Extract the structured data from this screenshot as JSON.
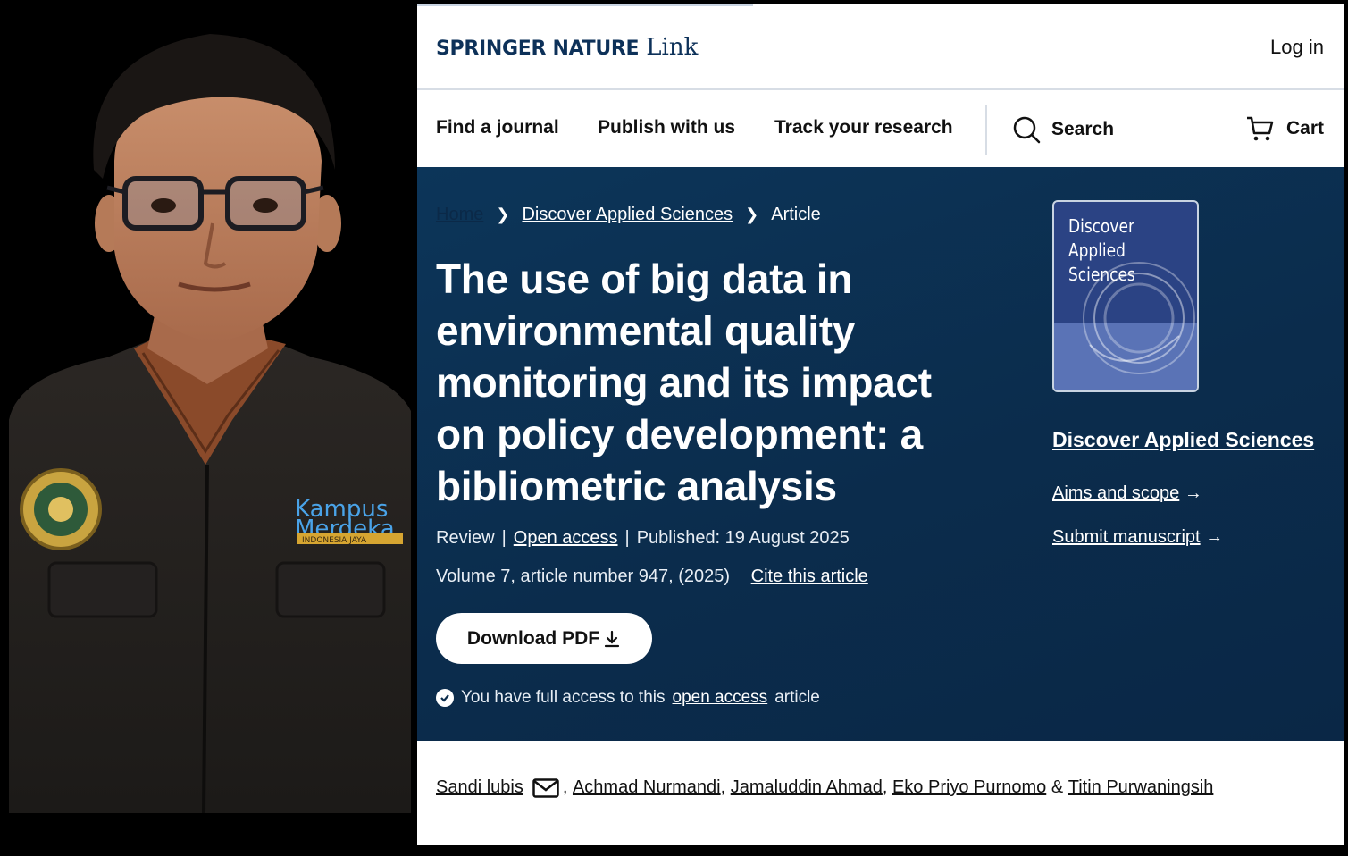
{
  "header": {
    "brand": "SPRINGER NATURE",
    "brand_suffix": "Link",
    "login_label": "Log in"
  },
  "nav": {
    "find_journal": "Find a journal",
    "publish": "Publish with us",
    "track": "Track your research",
    "search": "Search",
    "cart": "Cart"
  },
  "breadcrumb": {
    "home": "Home",
    "journal": "Discover Applied Sciences",
    "current": "Article"
  },
  "article": {
    "title": "The use of big data in environmental quality monitoring and its impact on policy development: a bibliometric analysis",
    "type": "Review",
    "open_access": "Open access",
    "published": "Published: 19 August 2025",
    "volume": "Volume 7, article number 947, (2025)",
    "cite": "Cite this article",
    "download": "Download PDF",
    "access_prefix": "You have full access to this",
    "access_link": "open access",
    "access_suffix": "article"
  },
  "sidebar": {
    "cover_title": "Discover Applied Sciences",
    "journal_link": "Discover Applied Sciences",
    "aims": "Aims and scope",
    "submit": "Submit manuscript"
  },
  "authors": [
    "Sandi lubis",
    "Achmad Nurmandi",
    "Jamaluddin Ahmad",
    "Eko Priyo Purnomo",
    "Titin Purwaningsih"
  ],
  "author_separator": ",",
  "author_and": "&",
  "photo": {
    "jacket_text_1": "Kampus",
    "jacket_text_2": "Merdeka",
    "jacket_text_3": "INDONESIA JAYA"
  },
  "colors": {
    "hero_bg": "#0b2c4c",
    "brand_navy": "#0d3159",
    "cover_blue": "#2b4384"
  }
}
